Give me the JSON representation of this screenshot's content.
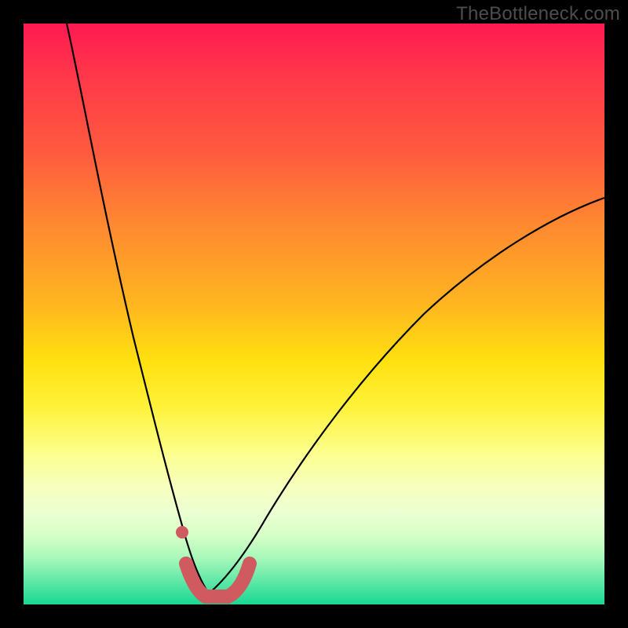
{
  "watermark": "TheBottleneck.com",
  "colors": {
    "frame": "#000000",
    "curve": "#000000",
    "marker": "#cf5a5f"
  },
  "chart_data": {
    "type": "line",
    "title": "",
    "xlabel": "",
    "ylabel": "",
    "xlim": [
      0,
      100
    ],
    "ylim": [
      0,
      100
    ],
    "x": [
      0,
      5,
      10,
      15,
      20,
      23,
      26,
      28,
      30,
      32,
      34,
      36,
      40,
      45,
      50,
      55,
      60,
      65,
      70,
      75,
      80,
      85,
      90,
      95,
      100
    ],
    "series": [
      {
        "name": "bottleneck-curve",
        "values": [
          100,
          86,
          72,
          57,
          40,
          27,
          16,
          10,
          5,
          2,
          1,
          3,
          8,
          16,
          24,
          31,
          38,
          44,
          49,
          54,
          58,
          62,
          65,
          68,
          70
        ]
      }
    ],
    "annotations": {
      "marker_start_dot": {
        "x": 27,
        "y": 13
      },
      "marker_path": [
        {
          "x": 27.5,
          "y": 8
        },
        {
          "x": 29,
          "y": 3.5
        },
        {
          "x": 31,
          "y": 1.8
        },
        {
          "x": 34,
          "y": 1.8
        },
        {
          "x": 36.5,
          "y": 3.5
        },
        {
          "x": 38,
          "y": 6.5
        }
      ]
    },
    "background_gradient": [
      {
        "pos": 0,
        "color": "#ff1a52"
      },
      {
        "pos": 50,
        "color": "#ffd020"
      },
      {
        "pos": 75,
        "color": "#fcff8e"
      },
      {
        "pos": 100,
        "color": "#18d892"
      }
    ]
  }
}
